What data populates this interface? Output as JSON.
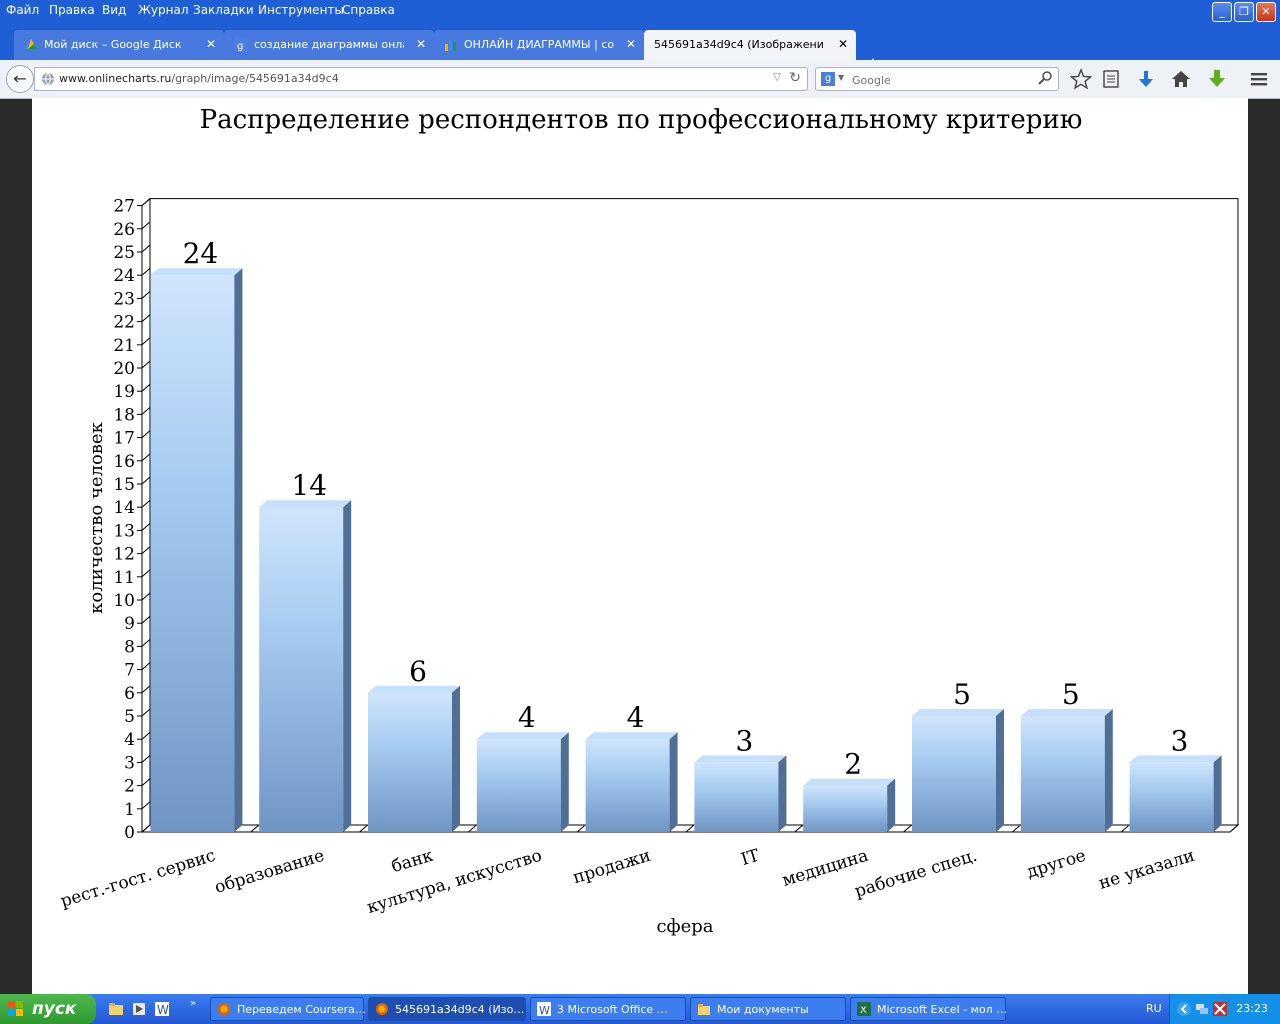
{
  "menu": [
    "Файл",
    "Правка",
    "Вид",
    "Журнал",
    "Закладки",
    "Инструменты",
    "Справка"
  ],
  "tabs": [
    {
      "title": "Мой диск – Google Диск",
      "icon": "google-drive-icon",
      "active": false
    },
    {
      "title": "создание диаграммы онлай…",
      "icon": "google-search-icon",
      "active": false
    },
    {
      "title": "ОНЛАЙН ДИАГРАММЫ | соз…",
      "icon": "chart-icon",
      "active": false
    },
    {
      "title": "545691a34d9c4 (Изображение P…",
      "icon": "",
      "active": true
    }
  ],
  "navbar": {
    "url_domain": "www.onlinecharts.ru",
    "url_path": "/graph/image/545691a34d9c4",
    "search_placeholder": "Google"
  },
  "chart_data": {
    "type": "bar",
    "title": "Распределение респондентов по профессиональному критерию",
    "xlabel": "сфера",
    "ylabel": "количество человек",
    "categories": [
      "рест.-гост. сервис",
      "образование",
      "банк",
      "культура, искусство",
      "продажи",
      "IT",
      "медицина",
      "рабочие спец.",
      "другое",
      "не указали"
    ],
    "values": [
      24,
      14,
      6,
      4,
      4,
      3,
      2,
      5,
      5,
      3
    ],
    "ylim": [
      0,
      27
    ],
    "yticks": [
      "0",
      "1",
      "2",
      "3",
      "4",
      "5",
      "6",
      "7",
      "8",
      "9",
      "10",
      "11",
      "12",
      "13",
      "14",
      "15",
      "16",
      "17",
      "18",
      "19",
      "20",
      "21",
      "22",
      "23",
      "24",
      "25",
      "26",
      "27"
    ],
    "grid": false,
    "bar_color": "#a9cdf2"
  },
  "taskbar": {
    "start_label": "пуск",
    "items": [
      {
        "label": "Переведем Coursera…",
        "icon": "firefox-icon",
        "active": false
      },
      {
        "label": "545691a34d9c4 (Изо…",
        "icon": "firefox-icon",
        "active": true
      },
      {
        "label": "3 Microsoft Office …",
        "icon": "word-icon",
        "active": false
      },
      {
        "label": "Мои документы",
        "icon": "folder-icon",
        "active": false
      },
      {
        "label": "Microsoft Excel - мол …",
        "icon": "excel-icon",
        "active": false
      }
    ],
    "lang": "RU",
    "clock": "23:23"
  }
}
